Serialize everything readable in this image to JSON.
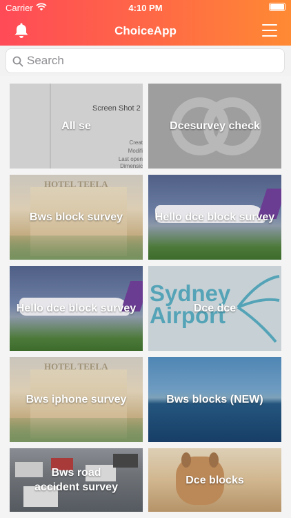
{
  "status_bar": {
    "carrier": "Carrier",
    "time": "4:10 PM"
  },
  "nav": {
    "title": "ChoiceApp",
    "left_icon": "bell-icon",
    "right_icon": "menu-icon"
  },
  "search": {
    "placeholder": "Search",
    "value": ""
  },
  "colors": {
    "gradient_start": "#ff4a57",
    "gradient_end": "#ff8a33"
  },
  "tiles": [
    {
      "label": "All se",
      "background": "screenshot"
    },
    {
      "label": "Dcesurvey check",
      "background": "gray-logo"
    },
    {
      "label": "Bws block survey",
      "background": "hotel"
    },
    {
      "label": "Hello dce block survey",
      "background": "airplane"
    },
    {
      "label": "Hello dce block survey",
      "background": "airplane"
    },
    {
      "label": "Dce dce",
      "background": "sydney-airport"
    },
    {
      "label": "Bws iphone survey",
      "background": "hotel"
    },
    {
      "label": "Bws  blocks (NEW)",
      "background": "ocean"
    },
    {
      "label": "Bws road accident survey",
      "background": "traffic"
    },
    {
      "label": "Dce blocks",
      "background": "deer"
    }
  ],
  "background_text": {
    "screenshot_title": "Screen Shot 2",
    "screenshot_meta": [
      "Creat",
      "Modifi",
      "Last open",
      "Dimensic"
    ],
    "hotel_sign": "HOTEL TEELA",
    "sydney_airport": [
      "Sydney",
      "Airport"
    ]
  }
}
